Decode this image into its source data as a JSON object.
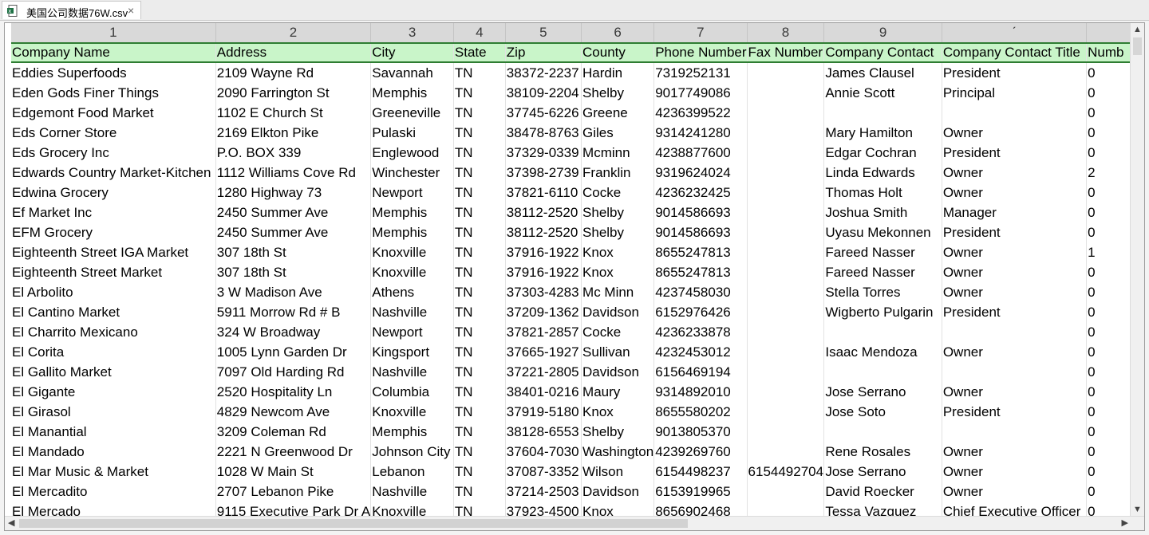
{
  "tab": {
    "title": "美国公司数据76W.csv",
    "close": "×",
    "icon": "excel-file-icon"
  },
  "column_numbers": [
    "1",
    "2",
    "3",
    "4",
    "5",
    "6",
    "7",
    "8",
    "9",
    "ˊ",
    ""
  ],
  "header": [
    "Company Name",
    "Address",
    "City",
    "State",
    "Zip",
    "County",
    "Phone Number",
    "Fax Number",
    "Company Contact",
    "Company Contact Title",
    "Numb"
  ],
  "rows": [
    [
      "Eddies Superfoods",
      "2109 Wayne Rd",
      "Savannah",
      "TN",
      "38372-2237",
      "Hardin",
      "7319252131",
      "",
      "James Clausel",
      "President",
      "0"
    ],
    [
      "Eden Gods Finer Things",
      "2090 Farrington St",
      "Memphis",
      "TN",
      "38109-2204",
      "Shelby",
      "9017749086",
      "",
      "Annie Scott",
      "Principal",
      "0"
    ],
    [
      "Edgemont Food Market",
      "1102 E Church St",
      "Greeneville",
      "TN",
      "37745-6226",
      "Greene",
      "4236399522",
      "",
      "",
      "",
      "0"
    ],
    [
      "Eds Corner Store",
      "2169 Elkton Pike",
      "Pulaski",
      "TN",
      "38478-8763",
      "Giles",
      "9314241280",
      "",
      "Mary Hamilton",
      "Owner",
      "0"
    ],
    [
      "Eds Grocery Inc",
      "P.O. BOX 339",
      "Englewood",
      "TN",
      "37329-0339",
      "Mcminn",
      "4238877600",
      "",
      "Edgar Cochran",
      "President",
      "0"
    ],
    [
      "Edwards Country Market-Kitchen",
      "1112 Williams Cove Rd",
      "Winchester",
      "TN",
      "37398-2739",
      "Franklin",
      "9319624024",
      "",
      "Linda Edwards",
      "Owner",
      "2"
    ],
    [
      "Edwina Grocery",
      "1280 Highway 73",
      "Newport",
      "TN",
      "37821-6110",
      "Cocke",
      "4236232425",
      "",
      "Thomas Holt",
      "Owner",
      "0"
    ],
    [
      "Ef Market Inc",
      "2450 Summer Ave",
      "Memphis",
      "TN",
      "38112-2520",
      "Shelby",
      "9014586693",
      "",
      "Joshua Smith",
      "Manager",
      "0"
    ],
    [
      "EFM Grocery",
      "2450 Summer Ave",
      "Memphis",
      "TN",
      "38112-2520",
      "Shelby",
      "9014586693",
      "",
      "Uyasu Mekonnen",
      "President",
      "0"
    ],
    [
      "Eighteenth Street IGA Market",
      "307 18th St",
      "Knoxville",
      "TN",
      "37916-1922",
      "Knox",
      "8655247813",
      "",
      "Fareed Nasser",
      "Owner",
      "1"
    ],
    [
      "Eighteenth Street Market",
      "307 18th St",
      "Knoxville",
      "TN",
      "37916-1922",
      "Knox",
      "8655247813",
      "",
      "Fareed Nasser",
      "Owner",
      "0"
    ],
    [
      "El Arbolito",
      "3 W Madison Ave",
      "Athens",
      "TN",
      "37303-4283",
      "Mc Minn",
      "4237458030",
      "",
      "Stella Torres",
      "Owner",
      "0"
    ],
    [
      "El Cantino Market",
      "5911 Morrow Rd # B",
      "Nashville",
      "TN",
      "37209-1362",
      "Davidson",
      "6152976426",
      "",
      "Wigberto Pulgarin",
      "President",
      "0"
    ],
    [
      "El Charrito Mexicano",
      "324 W Broadway",
      "Newport",
      "TN",
      "37821-2857",
      "Cocke",
      "4236233878",
      "",
      "",
      "",
      "0"
    ],
    [
      "El Corita",
      "1005 Lynn Garden Dr",
      "Kingsport",
      "TN",
      "37665-1927",
      "Sullivan",
      "4232453012",
      "",
      "Isaac Mendoza",
      "Owner",
      "0"
    ],
    [
      "El Gallito Market",
      "7097 Old Harding Rd",
      "Nashville",
      "TN",
      "37221-2805",
      "Davidson",
      "6156469194",
      "",
      "",
      "",
      "0"
    ],
    [
      "El Gigante",
      "2520 Hospitality Ln",
      "Columbia",
      "TN",
      "38401-0216",
      "Maury",
      "9314892010",
      "",
      "Jose Serrano",
      "Owner",
      "0"
    ],
    [
      "El Girasol",
      "4829 Newcom Ave",
      "Knoxville",
      "TN",
      "37919-5180",
      "Knox",
      "8655580202",
      "",
      "Jose Soto",
      "President",
      "0"
    ],
    [
      "El Manantial",
      "3209 Coleman Rd",
      "Memphis",
      "TN",
      "38128-6553",
      "Shelby",
      "9013805370",
      "",
      "",
      "",
      "0"
    ],
    [
      "El Mandado",
      "2221 N Greenwood Dr",
      "Johnson City",
      "TN",
      "37604-7030",
      "Washington",
      "4239269760",
      "",
      "Rene Rosales",
      "Owner",
      "0"
    ],
    [
      "El Mar Music & Market",
      "1028 W Main St",
      "Lebanon",
      "TN",
      "37087-3352",
      "Wilson",
      "6154498237",
      "6154492704",
      "Jose Serrano",
      "Owner",
      "0"
    ],
    [
      "El Mercadito",
      "2707 Lebanon Pike",
      "Nashville",
      "TN",
      "37214-2503",
      "Davidson",
      "6153919965",
      "",
      "David Roecker",
      "Owner",
      "0"
    ],
    [
      "El Mercado",
      "9115 Executive Park Dr A",
      "Knoxville",
      "TN",
      "37923-4500",
      "Knox",
      "8656902468",
      "",
      "Tessa Vazquez",
      "Chief Executive Officer",
      "0"
    ]
  ]
}
